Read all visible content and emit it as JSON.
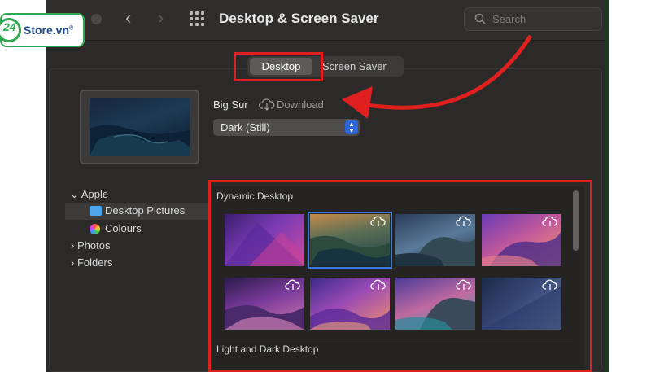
{
  "window": {
    "title": "Desktop & Screen Saver"
  },
  "toolbar": {
    "back_icon": "chevron-left-icon",
    "forward_icon": "chevron-right-icon",
    "grid_icon": "grid-icon"
  },
  "search": {
    "placeholder": "Search"
  },
  "watermark": {
    "brand_number": "24",
    "brand_text": "Store.vn",
    "brand_color": "#2fa84f"
  },
  "tabs": {
    "desktop_label": "Desktop",
    "screensaver_label": "Screen Saver",
    "selected": "Desktop"
  },
  "current_wallpaper": {
    "name": "Big Sur",
    "download_label": "Download",
    "mode_value": "Dark (Still)"
  },
  "sidebar": {
    "apple_label": "Apple",
    "desktop_pictures_label": "Desktop Pictures",
    "colours_label": "Colours",
    "photos_label": "Photos",
    "folders_label": "Folders",
    "selected": "Desktop Pictures"
  },
  "gallery": {
    "section1_title": "Dynamic Desktop",
    "section2_title": "Light and Dark Desktop",
    "selected_index": 1
  },
  "highlight_color": "#e0201f",
  "accent_color": "#2c64d9"
}
